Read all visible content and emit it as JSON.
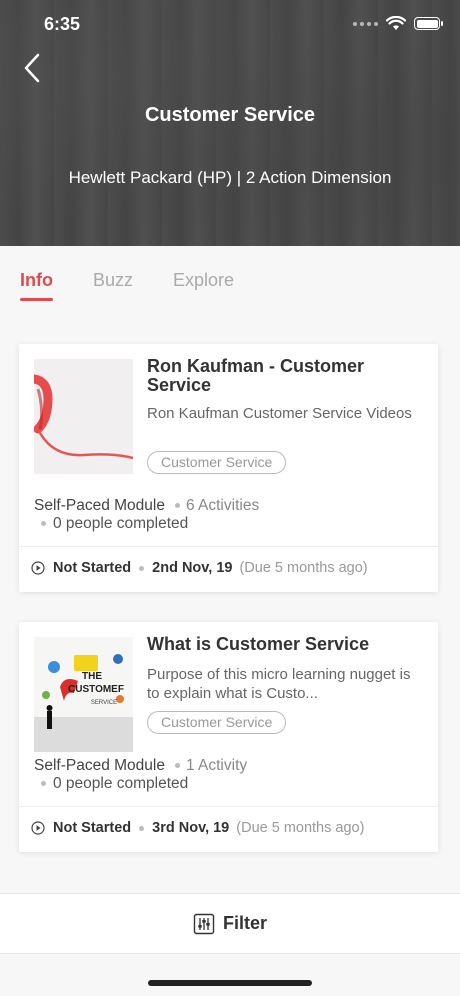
{
  "status_bar": {
    "time": "6:35"
  },
  "header": {
    "title": "Customer Service",
    "subtitle": "Hewlett Packard (HP) | 2 Action Dimension"
  },
  "tabs": [
    {
      "label": "Info",
      "active": true
    },
    {
      "label": "Buzz",
      "active": false
    },
    {
      "label": "Explore",
      "active": false
    }
  ],
  "cards": [
    {
      "title": "Ron Kaufman - Customer Service",
      "description": "Ron Kaufman Customer Service Videos",
      "tag": "Customer Service",
      "type": "Self-Paced Module",
      "activities": "6 Activities",
      "completed": "0 people completed",
      "status": "Not Started",
      "date": "2nd Nov, 19",
      "due": "(Due 5 months ago)"
    },
    {
      "title": "What is Customer Service",
      "description": "Purpose of this micro learning nugget is to explain what is Custo...",
      "tag": "Customer Service",
      "type": "Self-Paced Module",
      "activities": "1 Activity",
      "completed": "0 people completed",
      "status": "Not Started",
      "date": "3rd Nov, 19",
      "due": "(Due 5 months ago)"
    }
  ],
  "filter": {
    "label": "Filter"
  },
  "colors": {
    "accent": "#e24a4a"
  }
}
